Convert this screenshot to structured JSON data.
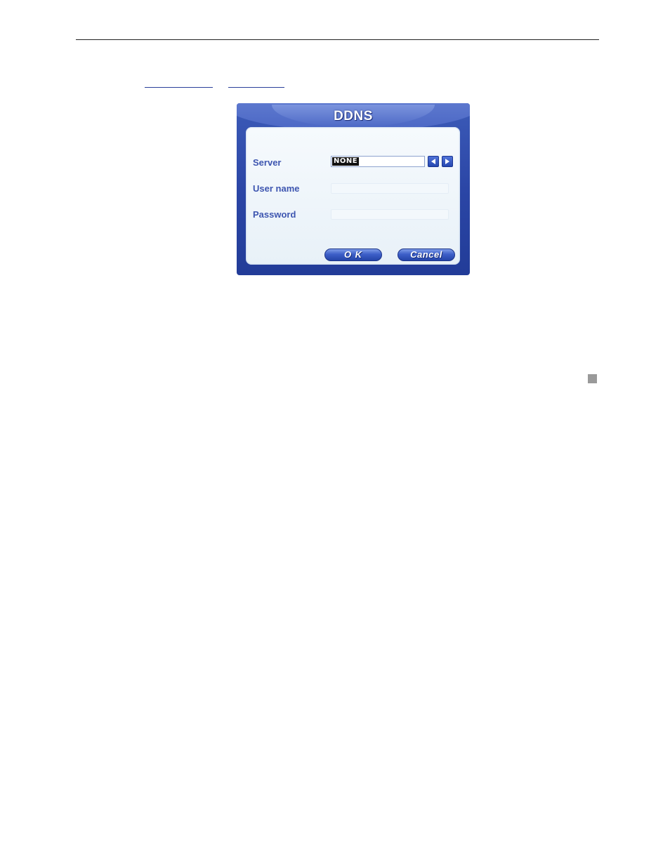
{
  "dialog": {
    "title": "DDNS",
    "fields": {
      "server_label": "Server",
      "server_value": "NONE",
      "username_label": "User name",
      "username_value": "",
      "password_label": "Password",
      "password_value": ""
    },
    "buttons": {
      "ok": "O K",
      "cancel": "Cancel"
    },
    "icons": {
      "prev": "arrow-left-icon",
      "next": "arrow-right-icon"
    },
    "colors": {
      "frame": "#2b46a6",
      "panel": "#eef5fa",
      "label": "#3d55b0"
    }
  }
}
